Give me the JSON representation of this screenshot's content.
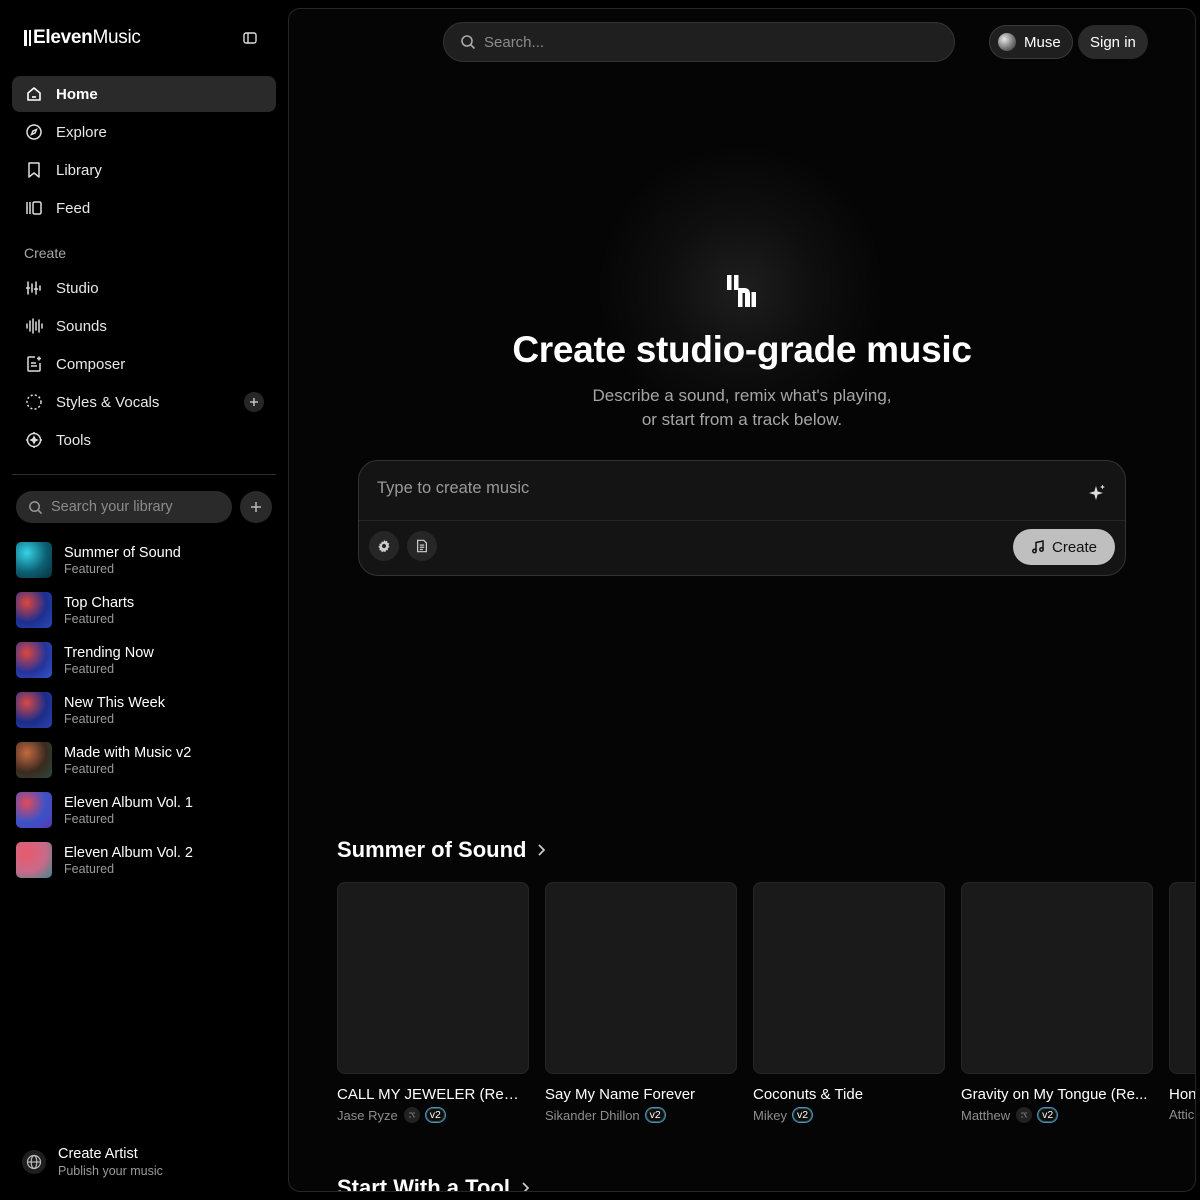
{
  "app": {
    "logo_bold": "Eleven",
    "logo_light": "Music"
  },
  "sidebar": {
    "nav": [
      {
        "label": "Home",
        "icon": "home-icon",
        "active": true
      },
      {
        "label": "Explore",
        "icon": "compass-icon"
      },
      {
        "label": "Library",
        "icon": "bookmark-icon"
      },
      {
        "label": "Feed",
        "icon": "feed-icon"
      }
    ],
    "create_label": "Create",
    "create_items": [
      {
        "label": "Studio",
        "icon": "studio-icon"
      },
      {
        "label": "Sounds",
        "icon": "waveform-icon"
      },
      {
        "label": "Composer",
        "icon": "composer-icon"
      },
      {
        "label": "Styles & Vocals",
        "icon": "styles-icon"
      },
      {
        "label": "Tools",
        "icon": "tools-icon"
      }
    ],
    "library_search_placeholder": "Search your library",
    "library": [
      {
        "title": "Summer of Sound",
        "subtitle": "Featured",
        "colors": [
          "#0c5f72",
          "#36d3e6",
          "#0a2f3d"
        ]
      },
      {
        "title": "Top Charts",
        "subtitle": "Featured",
        "colors": [
          "#1b2f8f",
          "#e0463d",
          "#2b49b8"
        ]
      },
      {
        "title": "Trending Now",
        "subtitle": "Featured",
        "colors": [
          "#23339b",
          "#e0463d",
          "#3556c9"
        ]
      },
      {
        "title": "New This Week",
        "subtitle": "Featured",
        "colors": [
          "#1b2c8a",
          "#d94a46",
          "#2a45ad"
        ]
      },
      {
        "title": "Made with Music v2",
        "subtitle": "Featured",
        "colors": [
          "#3a2a20",
          "#c46a40",
          "#2c4a3a"
        ]
      },
      {
        "title": "Eleven Album Vol. 1",
        "subtitle": "Featured",
        "colors": [
          "#3a52c8",
          "#e24a5a",
          "#5a3ab0"
        ]
      },
      {
        "title": "Eleven Album Vol. 2",
        "subtitle": "Featured",
        "colors": [
          "#c86a8a",
          "#e85a6a",
          "#3a8a8a"
        ]
      }
    ],
    "create_artist": {
      "title": "Create Artist",
      "subtitle": "Publish your music"
    }
  },
  "header": {
    "search_placeholder": "Search...",
    "muse_label": "Muse",
    "signin_label": "Sign in"
  },
  "hero": {
    "title": "Create studio-grade music",
    "subtitle": "Describe a sound, remix what's playing, or start from a track below."
  },
  "prompt": {
    "placeholder": "Type to create music",
    "create_label": "Create"
  },
  "sections": {
    "summer": {
      "title": "Summer of Sound",
      "tracks": [
        {
          "title": "CALL MY JEWELER (Remix)",
          "artist": "Jase Ryze",
          "remix": true,
          "badge": "v2"
        },
        {
          "title": "Say My Name Forever",
          "artist": "Sikander Dhillon",
          "remix": false,
          "badge": "v2"
        },
        {
          "title": "Coconuts & Tide",
          "artist": "Mikey",
          "remix": false,
          "badge": "v2"
        },
        {
          "title": "Gravity on My Tongue (Re...",
          "artist": "Matthew",
          "remix": true,
          "badge": "v2"
        },
        {
          "title": "Hon",
          "artist": "Attic",
          "remix": false,
          "badge": ""
        }
      ]
    },
    "tools": {
      "title": "Start With a Tool"
    }
  }
}
